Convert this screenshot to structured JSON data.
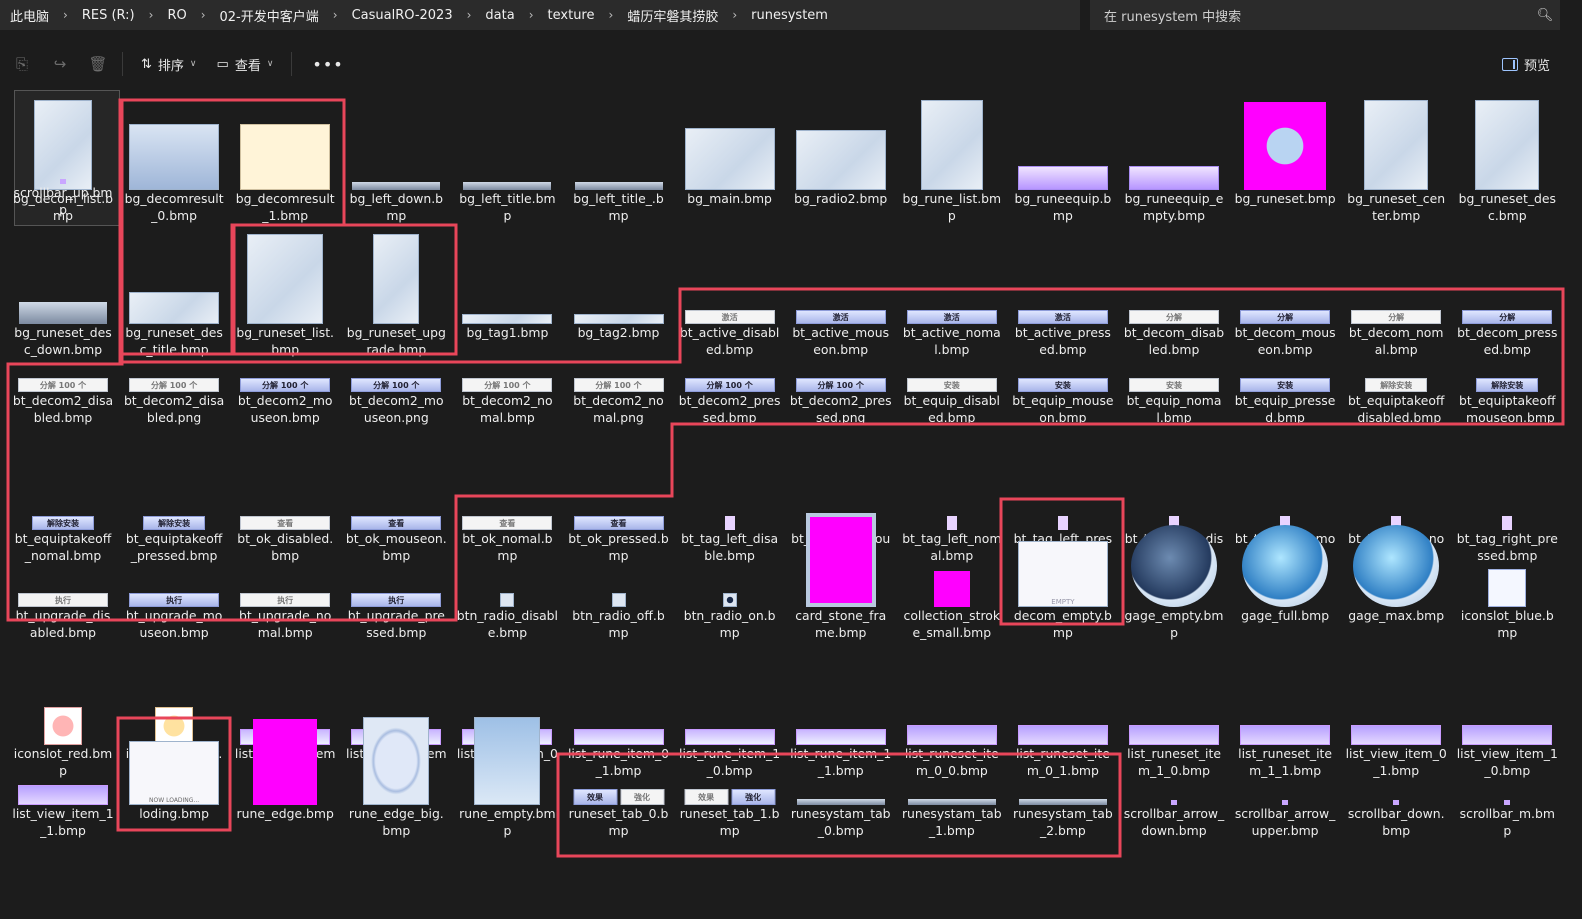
{
  "breadcrumb": [
    "此电脑",
    "RES (R:)",
    "RO",
    "02-开发中客户端",
    "CasualRO-2023",
    "data",
    "texture",
    "蜡历牢磐其捞胶",
    "runesystem"
  ],
  "search": {
    "placeholder": "在 runesystem 中搜索",
    "icon": "search-icon"
  },
  "toolbar": {
    "sort_label": "排序",
    "view_label": "查看",
    "more_label": "•••",
    "preview_label": "预览"
  },
  "files": [
    "bg_decom_list.bmp",
    "bg_decomresult_0.bmp",
    "bg_decomresult_1.bmp",
    "bg_left_down.bmp",
    "bg_left_title.bmp",
    "bg_left_title_.bmp",
    "bg_main.bmp",
    "bg_radio2.bmp",
    "bg_rune_list.bmp",
    "bg_runeequip.bmp",
    "bg_runeequip_empty.bmp",
    "bg_runeset.bmp",
    "bg_runeset_center.bmp",
    "bg_runeset_desc.bmp",
    "bg_runeset_desc_down.bmp",
    "bg_runeset_desc_title.bmp",
    "bg_runeset_list.bmp",
    "bg_runeset_upgrade.bmp",
    "bg_tag1.bmp",
    "bg_tag2.bmp",
    "bt_active_disabled.bmp",
    "bt_active_mouseon.bmp",
    "bt_active_nomal.bmp",
    "bt_active_pressed.bmp",
    "bt_decom_disabled.bmp",
    "bt_decom_mouseon.bmp",
    "bt_decom_nomal.bmp",
    "bt_decom_pressed.bmp",
    "bt_decom2_disabled.bmp",
    "bt_decom2_disabled.png",
    "bt_decom2_mouseon.bmp",
    "bt_decom2_mouseon.png",
    "bt_decom2_nomal.bmp",
    "bt_decom2_nomal.png",
    "bt_decom2_pressed.bmp",
    "bt_decom2_pressed.png",
    "bt_equip_disabled.bmp",
    "bt_equip_mouseon.bmp",
    "bt_equip_nomal.bmp",
    "bt_equip_pressed.bmp",
    "bt_equiptakeoff_disabled.bmp",
    "bt_equiptakeoff_mouseon.bmp",
    "bt_equiptakeoff_nomal.bmp",
    "bt_equiptakeoff_pressed.bmp",
    "bt_ok_disabled.bmp",
    "bt_ok_mouseon.bmp",
    "bt_ok_nomal.bmp",
    "bt_ok_pressed.bmp",
    "bt_tag_left_disable.bmp",
    "bt_tag_left_mouseon.bmp",
    "bt_tag_left_nomal.bmp",
    "bt_tag_left_pressed.bmp",
    "bt_tag_right_disable.bmp",
    "bt_tag_right_mouseon.bmp",
    "bt_tag_right_nomal.bmp",
    "bt_tag_right_pressed.bmp",
    "bt_upgrade_disabled.bmp",
    "bt_upgrade_mouseon.bmp",
    "bt_upgrade_nomal.bmp",
    "bt_upgrade_pressed.bmp",
    "btn_radio_disable.bmp",
    "btn_radio_off.bmp",
    "btn_radio_on.bmp",
    "card_stone_frame.bmp",
    "collection_stroke_small.bmp",
    "decom_empty.bmp",
    "gage_empty.bmp",
    "gage_full.bmp",
    "gage_max.bmp",
    "iconslot_blue.bmp",
    "iconslot_red.bmp",
    "iconslot_yellow.bmp",
    "list_decom_item_1_0.bmp",
    "list_decom_item_1_1.bmp",
    "list_rune_item_0_0.bmp",
    "list_rune_item_0_1.bmp",
    "list_rune_item_1_0.bmp",
    "list_rune_item_1_1.bmp",
    "list_runeset_item_0_0.bmp",
    "list_runeset_item_0_1.bmp",
    "list_runeset_item_1_0.bmp",
    "list_runeset_item_1_1.bmp",
    "list_view_item_0_1.bmp",
    "list_view_item_1_0.bmp",
    "list_view_item_1_1.bmp",
    "loding.bmp",
    "rune_edge.bmp",
    "rune_edge_big.bmp",
    "rune_empty.bmp",
    "runeset_tab_0.bmp",
    "runeset_tab_1.bmp",
    "runesystam_tab_0.bmp",
    "runesystam_tab_1.bmp",
    "runesystam_tab_2.bmp",
    "scrollbar_arrow_down.bmp",
    "scrollbar_arrow_upper.bmp",
    "scrollbar_down.bmp",
    "scrollbar_m.bmp",
    "scrollbar_up.bmp"
  ],
  "thumb_labels": {
    "decom2": "分解 100 个",
    "decom": "分解",
    "active": "激活",
    "equip": "安装",
    "takeoff": "解除安装",
    "ok": "查看",
    "upgrade": "执行",
    "tab_a": "效果",
    "tab_b": "強化",
    "empty": "EMPTY",
    "loading": "NOW LOADING..."
  },
  "colors": {
    "highlight": "#e8465a",
    "background": "#1c1c1c",
    "bar": "#2b2b2b"
  }
}
